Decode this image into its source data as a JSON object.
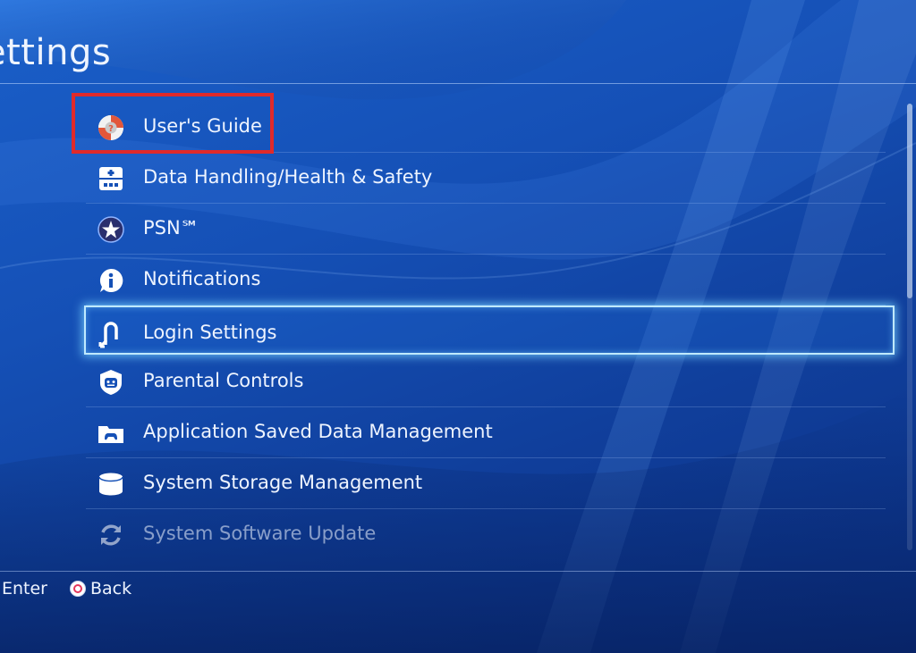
{
  "header": {
    "title": "ettings"
  },
  "menu": {
    "items": [
      {
        "label": "User's Guide",
        "icon": "lifebuoy-icon"
      },
      {
        "label": "Data Handling/Health & Safety",
        "icon": "document-icon"
      },
      {
        "label": "PSN℠",
        "icon": "psn-icon"
      },
      {
        "label": "Notifications",
        "icon": "info-icon"
      },
      {
        "label": "Login Settings",
        "icon": "login-icon"
      },
      {
        "label": "Parental Controls",
        "icon": "shield-icon"
      },
      {
        "label": "Application Saved Data Management",
        "icon": "folder-icon"
      },
      {
        "label": "System Storage Management",
        "icon": "storage-icon"
      },
      {
        "label": "System Software Update",
        "icon": "update-icon"
      }
    ],
    "focused_item": "Login Settings",
    "highlighted_item": "User's Guide"
  },
  "footer": {
    "enter_label": "Enter",
    "back_label": "Back",
    "back_icon": "circle-button-icon"
  },
  "colors": {
    "background": "#1550b6",
    "highlight_border": "#e02a2a",
    "focus_glow": "#bfe9ff",
    "circle_button": "#e3365d"
  }
}
